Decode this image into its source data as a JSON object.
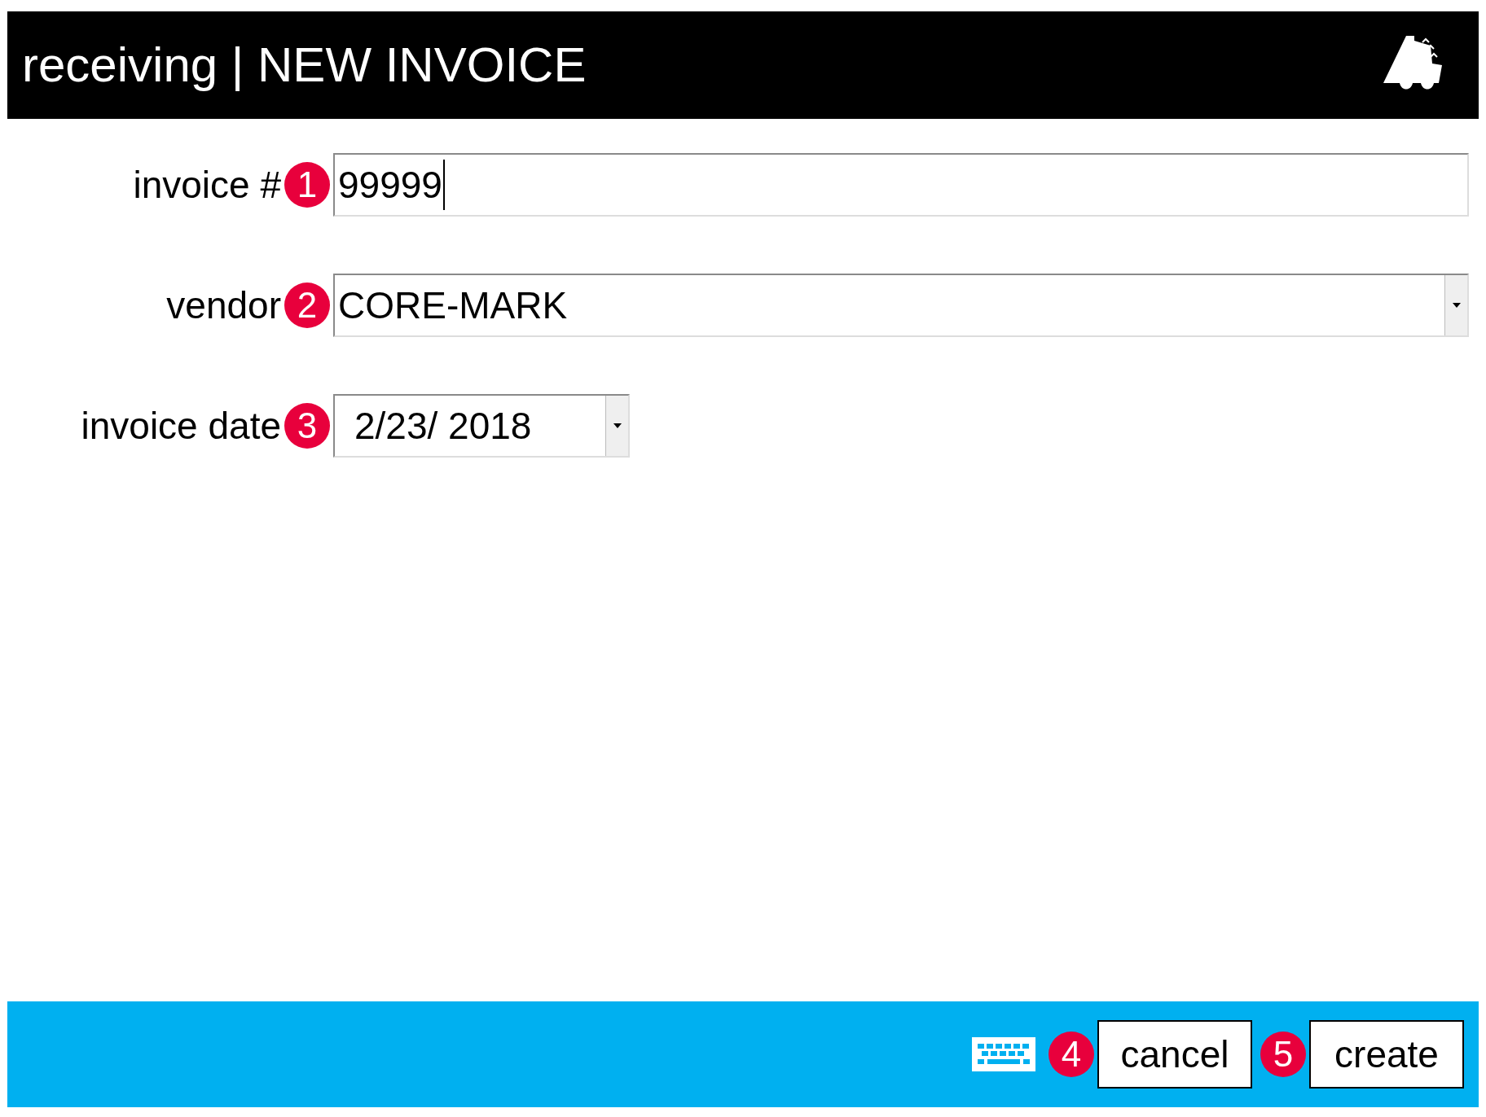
{
  "header": {
    "title": "receiving | NEW INVOICE"
  },
  "fields": [
    {
      "kind": "text",
      "label": "invoice #",
      "badge": "1",
      "value": "99999"
    },
    {
      "kind": "dropdown",
      "label": "vendor",
      "badge": "2",
      "value": "CORE-MARK"
    },
    {
      "kind": "date",
      "label": "invoice date",
      "badge": "3",
      "value": "2/23/ 2018"
    }
  ],
  "footer": {
    "buttons": [
      {
        "label": "cancel",
        "badge": "4"
      },
      {
        "label": "create",
        "badge": "5"
      }
    ]
  }
}
